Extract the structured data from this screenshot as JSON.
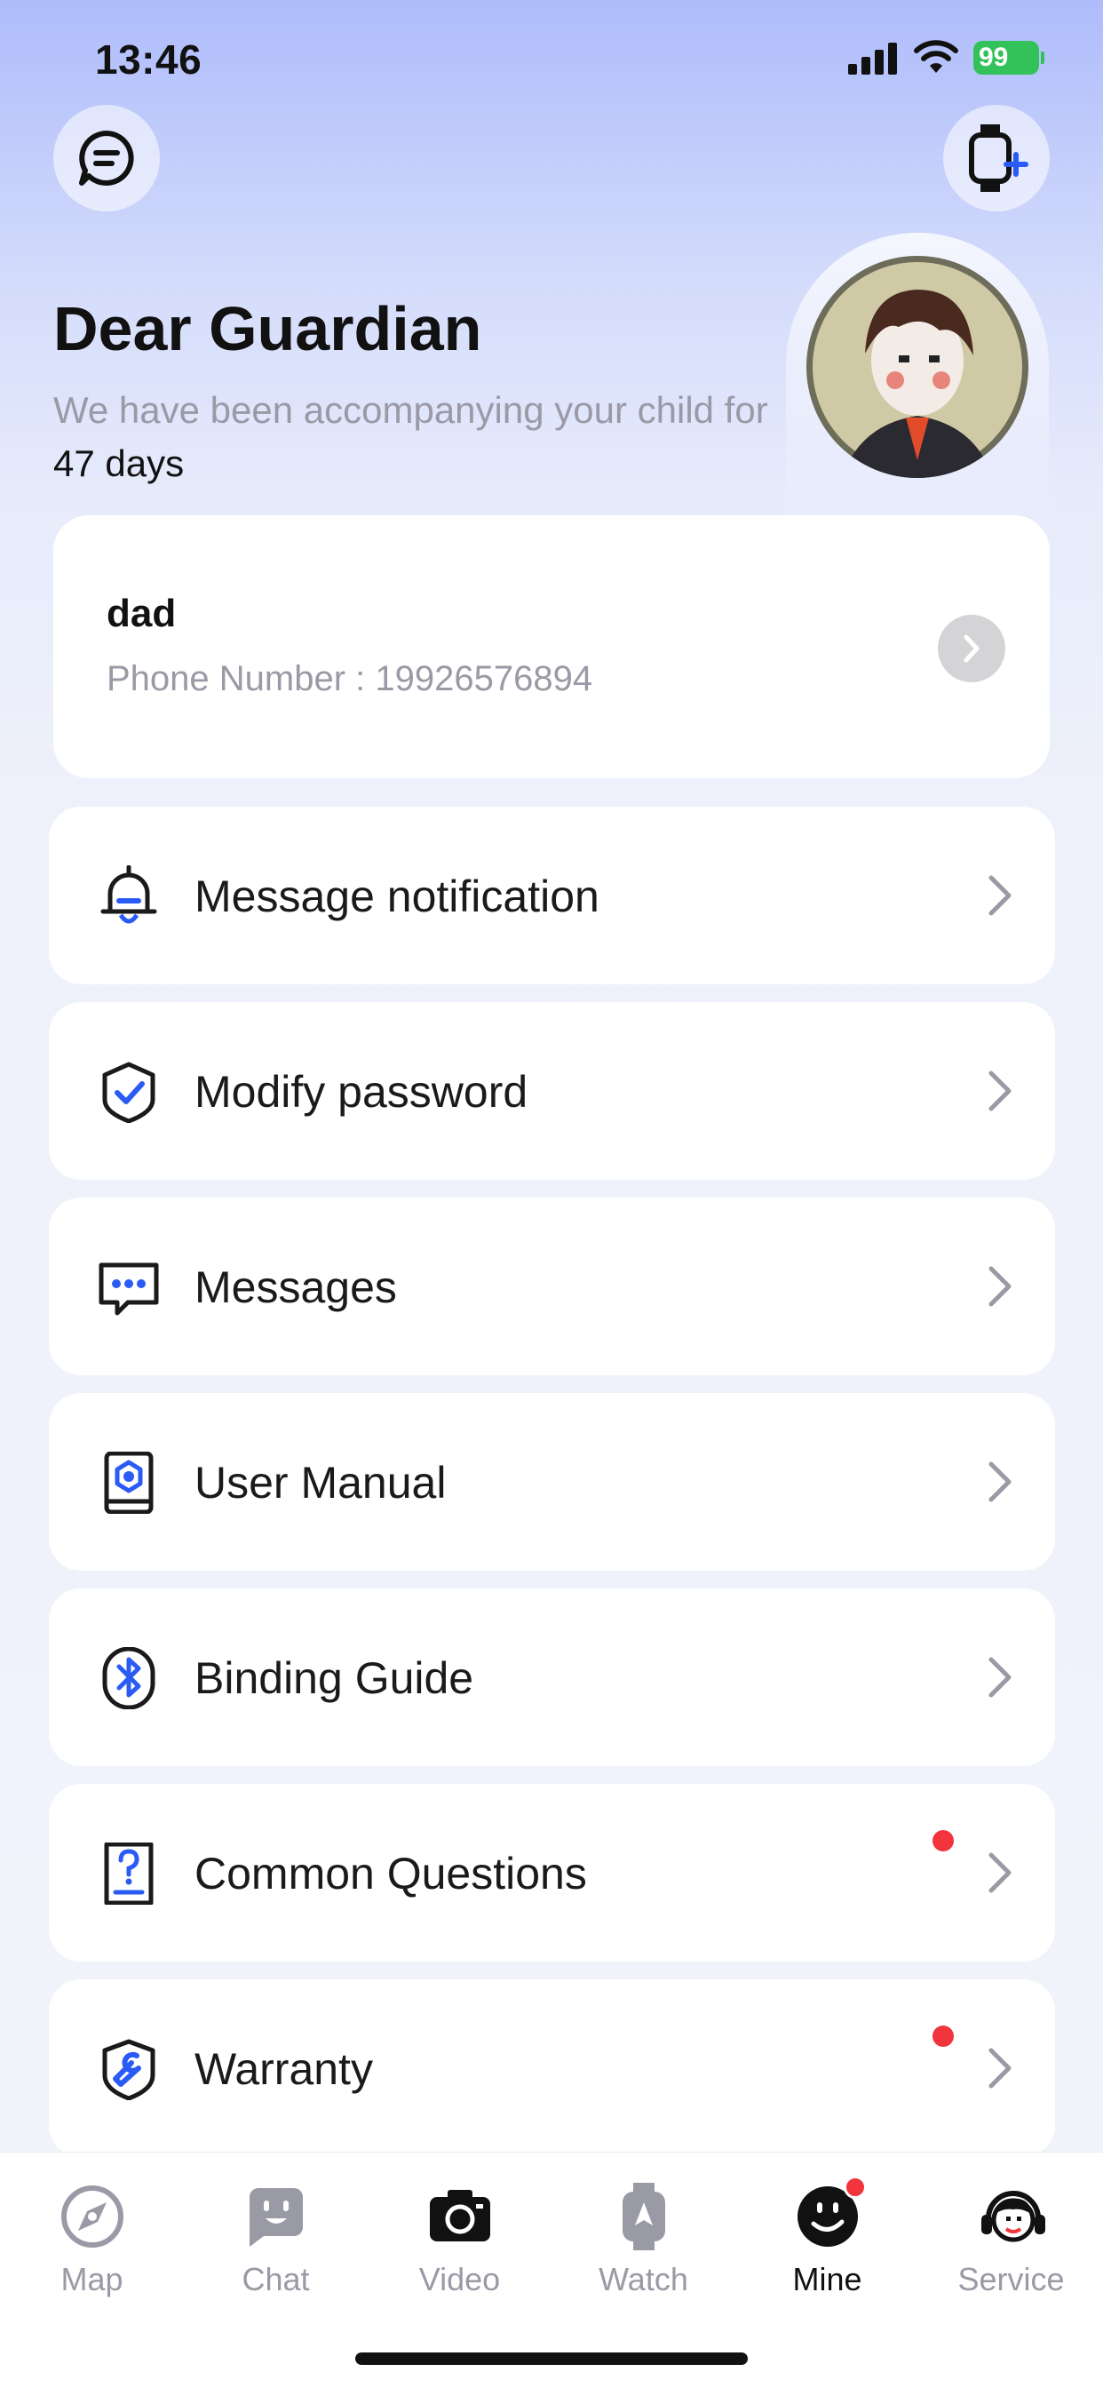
{
  "status": {
    "time": "13:46",
    "battery": "99"
  },
  "header": {
    "menu_icon": "chat-menu-icon",
    "add_watch_icon": "watch-add-icon"
  },
  "greeting": {
    "title": "Dear Guardian",
    "subtitle_prefix": "We have been accompanying your child for ",
    "days": "47 days"
  },
  "profile": {
    "name": "dad",
    "phone": "Phone Number : 19926576894"
  },
  "menu": {
    "items": [
      {
        "label": "Message notification",
        "icon": "bell-icon",
        "badge": false
      },
      {
        "label": "Modify password",
        "icon": "shield-check-icon",
        "badge": false
      },
      {
        "label": "Messages",
        "icon": "message-icon",
        "badge": false
      },
      {
        "label": "User Manual",
        "icon": "manual-icon",
        "badge": false
      },
      {
        "label": "Binding Guide",
        "icon": "bluetooth-icon",
        "badge": false
      },
      {
        "label": "Common Questions",
        "icon": "question-icon",
        "badge": true
      },
      {
        "label": "Warranty",
        "icon": "wrench-shield-icon",
        "badge": true
      }
    ]
  },
  "tabs": [
    {
      "label": "Map",
      "icon": "compass-icon",
      "active": false
    },
    {
      "label": "Chat",
      "icon": "chat-face-icon",
      "active": false
    },
    {
      "label": "Video",
      "icon": "camera-icon",
      "active": false
    },
    {
      "label": "Watch",
      "icon": "watch-icon",
      "active": false
    },
    {
      "label": "Mine",
      "icon": "smile-icon",
      "active": true,
      "badge": true
    },
    {
      "label": "Service",
      "icon": "headset-icon",
      "active": false
    }
  ],
  "colors": {
    "accent": "#2a5bf5",
    "badge": "#f2343c",
    "battery": "#33c25a"
  }
}
